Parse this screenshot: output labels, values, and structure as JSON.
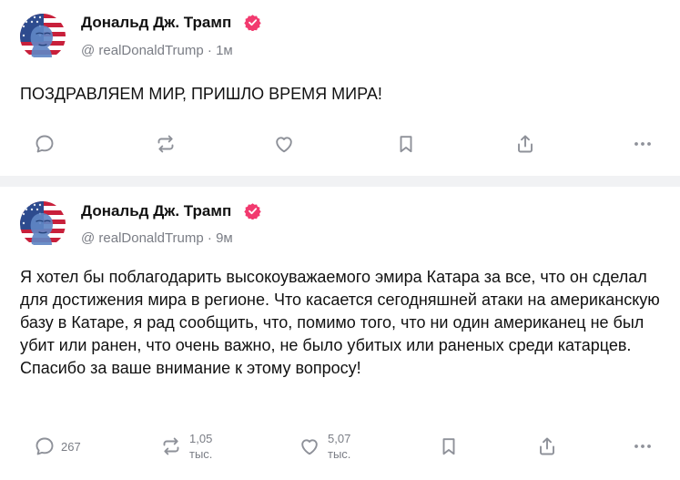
{
  "posts": [
    {
      "author": {
        "name": "Дональд Дж. Трамп",
        "handle": "@ realDonaldTrump",
        "time": "1м",
        "verified_icon": "verified-badge-icon",
        "badge_color": "#f23a6f"
      },
      "text": "ПОЗДРАВЛЯЕМ МИР, ПРИШЛО ВРЕМЯ МИРА!",
      "actions": {
        "reply_count": "",
        "repost_count_value": "",
        "repost_count_unit": "",
        "like_count_value": "",
        "like_count_unit": ""
      }
    },
    {
      "author": {
        "name": "Дональд Дж. Трамп",
        "handle": "@ realDonaldTrump",
        "time": "9м",
        "verified_icon": "verified-badge-icon",
        "badge_color": "#f23a6f"
      },
      "text": "Я хотел бы поблагодарить высокоуважаемого эмира Катара за все, что он сделал для достижения мира в регионе. Что касается сегодняшней атаки на американскую базу в Катаре, я рад сообщить, что, помимо того, что ни один американец не был убит или ранен, что очень важно, не было убитых или раненых среди катарцев. Спасибо за ваше внимание к этому вопросу!",
      "actions": {
        "reply_count": "267",
        "repost_count_value": "1,05",
        "repost_count_unit": "тыс.",
        "like_count_value": "5,07",
        "like_count_unit": "тыс."
      }
    }
  ],
  "icons": [
    "reply-icon",
    "repost-icon",
    "like-icon",
    "bookmark-icon",
    "share-icon",
    "more-icon"
  ],
  "colors": {
    "icon": "#8e9199",
    "secondary_text": "#7a7d85",
    "separator": "#f1f2f4",
    "verified": "#f23a6f"
  }
}
